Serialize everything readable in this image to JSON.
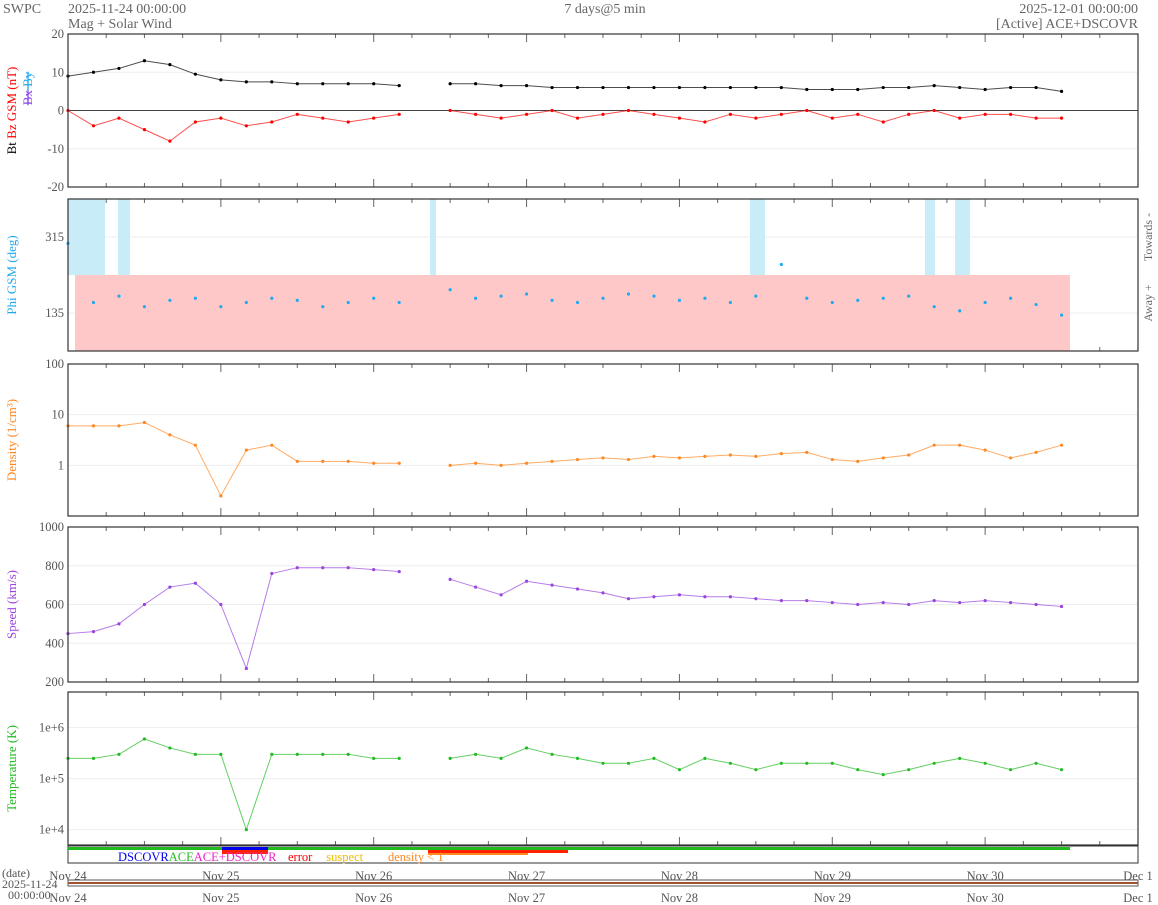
{
  "header": {
    "org": "SWPC",
    "start": "2025-11-24 00:00:00",
    "subtitle": "Mag + Solar Wind",
    "span": "7 days@5 min",
    "end": "2025-12-01 00:00:00",
    "source": "[Active] ACE+DSCOVR"
  },
  "chart_data": [
    {
      "type": "line",
      "title": "Mag",
      "ylabel_parts": {
        "bt": "Bt",
        "bz": "Bz GSM (nT)",
        "bx": "Bx",
        "by": "By"
      },
      "ylim": [
        -20,
        20
      ],
      "yticks": [
        "20",
        "10",
        "0",
        "-10",
        "-20"
      ],
      "ytick_values": [
        20,
        10,
        0,
        -10,
        -20
      ],
      "colors": {
        "bt": "#000000",
        "bz": "#ff0000",
        "bx": "#8844ee",
        "by": "#22aaee"
      },
      "x_hours": [
        0,
        4,
        8,
        12,
        16,
        20,
        24,
        28,
        32,
        36,
        40,
        44,
        48,
        52,
        56,
        60,
        64,
        68,
        72,
        76,
        80,
        84,
        88,
        92,
        96,
        100,
        104,
        108,
        112,
        116,
        120,
        124,
        128,
        132,
        136,
        140,
        144,
        148,
        152,
        156
      ],
      "series": [
        {
          "name": "Bt",
          "values": [
            9,
            10,
            11,
            13,
            12,
            9.5,
            8,
            7.5,
            7.5,
            7,
            7,
            7,
            7,
            6.5,
            null,
            7,
            7,
            6.5,
            6.5,
            6,
            6,
            6,
            6,
            6,
            6,
            6,
            6,
            6,
            6,
            5.5,
            5.5,
            5.5,
            6,
            6,
            6.5,
            6,
            5.5,
            6,
            6,
            5
          ]
        },
        {
          "name": "Bz",
          "values": [
            0,
            -4,
            -2,
            -5,
            -8,
            -3,
            -2,
            -4,
            -3,
            -1,
            -2,
            -3,
            -2,
            -1,
            null,
            0,
            -1,
            -2,
            -1,
            0,
            -2,
            -1,
            0,
            -1,
            -2,
            -3,
            -1,
            -2,
            -1,
            0,
            -2,
            -1,
            -3,
            -1,
            0,
            -2,
            -1,
            -1,
            -2,
            -2
          ]
        }
      ]
    },
    {
      "type": "scatter",
      "title": "Phi",
      "ylabel": "Phi GSM (deg)",
      "right_labels": {
        "towards": "Towards -",
        "away": "Away +"
      },
      "ylim": [
        45,
        405
      ],
      "yticks": [
        "315",
        "135"
      ],
      "ytick_values": [
        315,
        135
      ],
      "color": "#22aaee",
      "values": [
        300,
        160,
        175,
        150,
        165,
        170,
        150,
        160,
        170,
        165,
        150,
        160,
        170,
        160,
        null,
        190,
        170,
        175,
        180,
        165,
        160,
        170,
        180,
        175,
        165,
        170,
        160,
        175,
        250,
        170,
        160,
        165,
        170,
        175,
        150,
        140,
        160,
        170,
        155,
        130
      ]
    },
    {
      "type": "line",
      "title": "Density",
      "ylabel": "Density (1/cm³)",
      "scale": "log",
      "ylim": [
        0.1,
        100
      ],
      "yticks": [
        "100",
        "10",
        "1"
      ],
      "ytick_values": [
        100,
        10,
        1
      ],
      "color": "#ff8822",
      "values": [
        6,
        6,
        6,
        7,
        4,
        2.5,
        0.25,
        2,
        2.5,
        1.2,
        1.2,
        1.2,
        1.1,
        1.1,
        null,
        1,
        1.1,
        1,
        1.1,
        1.2,
        1.3,
        1.4,
        1.3,
        1.5,
        1.4,
        1.5,
        1.6,
        1.5,
        1.7,
        1.8,
        1.3,
        1.2,
        1.4,
        1.6,
        2.5,
        2.5,
        2,
        1.4,
        1.8,
        2.5
      ]
    },
    {
      "type": "line",
      "title": "Speed",
      "ylabel": "Speed (km/s)",
      "ylim": [
        200,
        1000
      ],
      "yticks": [
        "1000",
        "800",
        "600",
        "400",
        "200"
      ],
      "ytick_values": [
        1000,
        800,
        600,
        400,
        200
      ],
      "color": "#9944dd",
      "values": [
        450,
        460,
        500,
        600,
        690,
        710,
        600,
        270,
        760,
        790,
        790,
        790,
        780,
        770,
        null,
        730,
        690,
        650,
        720,
        700,
        680,
        660,
        630,
        640,
        650,
        640,
        640,
        630,
        620,
        620,
        610,
        600,
        610,
        600,
        620,
        610,
        620,
        610,
        600,
        590
      ]
    },
    {
      "type": "line",
      "title": "Temperature",
      "ylabel": "Temperature (K)",
      "scale": "log",
      "ylim": [
        5000,
        5000000
      ],
      "yticks": [
        "1e+6",
        "1e+5",
        "1e+4"
      ],
      "ytick_values": [
        1000000,
        100000,
        10000
      ],
      "color": "#22bb22",
      "values": [
        250000,
        250000,
        300000,
        600000,
        400000,
        300000,
        300000,
        10000,
        300000,
        300000,
        300000,
        300000,
        250000,
        250000,
        null,
        250000,
        300000,
        250000,
        400000,
        300000,
        250000,
        200000,
        200000,
        250000,
        150000,
        250000,
        200000,
        150000,
        200000,
        200000,
        200000,
        150000,
        120000,
        150000,
        200000,
        250000,
        200000,
        150000,
        200000,
        150000
      ]
    }
  ],
  "xaxis": {
    "ticks": [
      "Nov 24",
      "Nov 25",
      "Nov 26",
      "Nov 27",
      "Nov 28",
      "Nov 29",
      "Nov 30",
      "Dec 1"
    ],
    "range_days": [
      0,
      7
    ],
    "date_label": "(date)",
    "date_start": "2025-11-24",
    "time_start": "00:00:00"
  },
  "legend": [
    {
      "label": "DSCOVR",
      "color": "#0000ee"
    },
    {
      "label": "ACE",
      "color": "#22bb22"
    },
    {
      "label": "ACE+DSCOVR",
      "color": "#ee22cc"
    },
    {
      "label": "error",
      "color": "#ff0000"
    },
    {
      "label": "suspect",
      "color": "#eebb00"
    },
    {
      "label": "density < 1",
      "color": "#ff8822"
    }
  ]
}
